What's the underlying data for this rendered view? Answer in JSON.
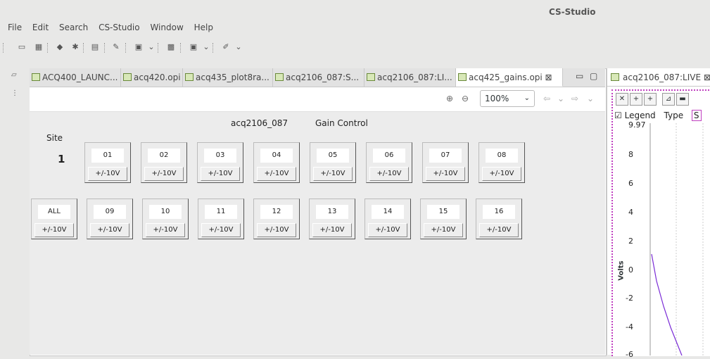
{
  "app": {
    "title": "CS-Studio"
  },
  "menu": [
    "File",
    "Edit",
    "Search",
    "CS-Studio",
    "Window",
    "Help"
  ],
  "tabs": [
    {
      "label": "ACQ400_LAUNC..."
    },
    {
      "label": "acq420.opi"
    },
    {
      "label": "acq435_plot8ra..."
    },
    {
      "label": "acq2106_087:S..."
    },
    {
      "label": "acq2106_087:LI..."
    },
    {
      "label": "acq425_gains.opi ⊠"
    }
  ],
  "editor_controls": {
    "minimize": "▭",
    "maximize": "▢"
  },
  "zoom": {
    "value": "100%"
  },
  "opi": {
    "title": "acq2106_087",
    "subtitle": "Gain Control",
    "site_label": "Site",
    "site_value": "1",
    "row1": [
      {
        "num": "01",
        "gain": "+/-10V"
      },
      {
        "num": "02",
        "gain": "+/-10V"
      },
      {
        "num": "03",
        "gain": "+/-10V"
      },
      {
        "num": "04",
        "gain": "+/-10V"
      },
      {
        "num": "05",
        "gain": "+/-10V"
      },
      {
        "num": "06",
        "gain": "+/-10V"
      },
      {
        "num": "07",
        "gain": "+/-10V"
      },
      {
        "num": "08",
        "gain": "+/-10V"
      }
    ],
    "row2": [
      {
        "num": "ALL",
        "gain": "+/-10V"
      },
      {
        "num": "09",
        "gain": "+/-10V"
      },
      {
        "num": "10",
        "gain": "+/-10V"
      },
      {
        "num": "11",
        "gain": "+/-10V"
      },
      {
        "num": "12",
        "gain": "+/-10V"
      },
      {
        "num": "13",
        "gain": "+/-10V"
      },
      {
        "num": "14",
        "gain": "+/-10V"
      },
      {
        "num": "15",
        "gain": "+/-10V"
      },
      {
        "num": "16",
        "gain": "+/-10V"
      }
    ]
  },
  "right": {
    "tab_label": "acq2106_087:LIVE ⊠",
    "legend_label": "Legend",
    "type_label": "Type",
    "s_label": "S",
    "ylabel": "Volts",
    "yticks": [
      "9.97",
      "8",
      "6",
      "4",
      "2",
      "0",
      "-2",
      "-4",
      "-6"
    ]
  },
  "colors": {
    "trace": "#7a2bd6",
    "frame": "#c040c0"
  }
}
